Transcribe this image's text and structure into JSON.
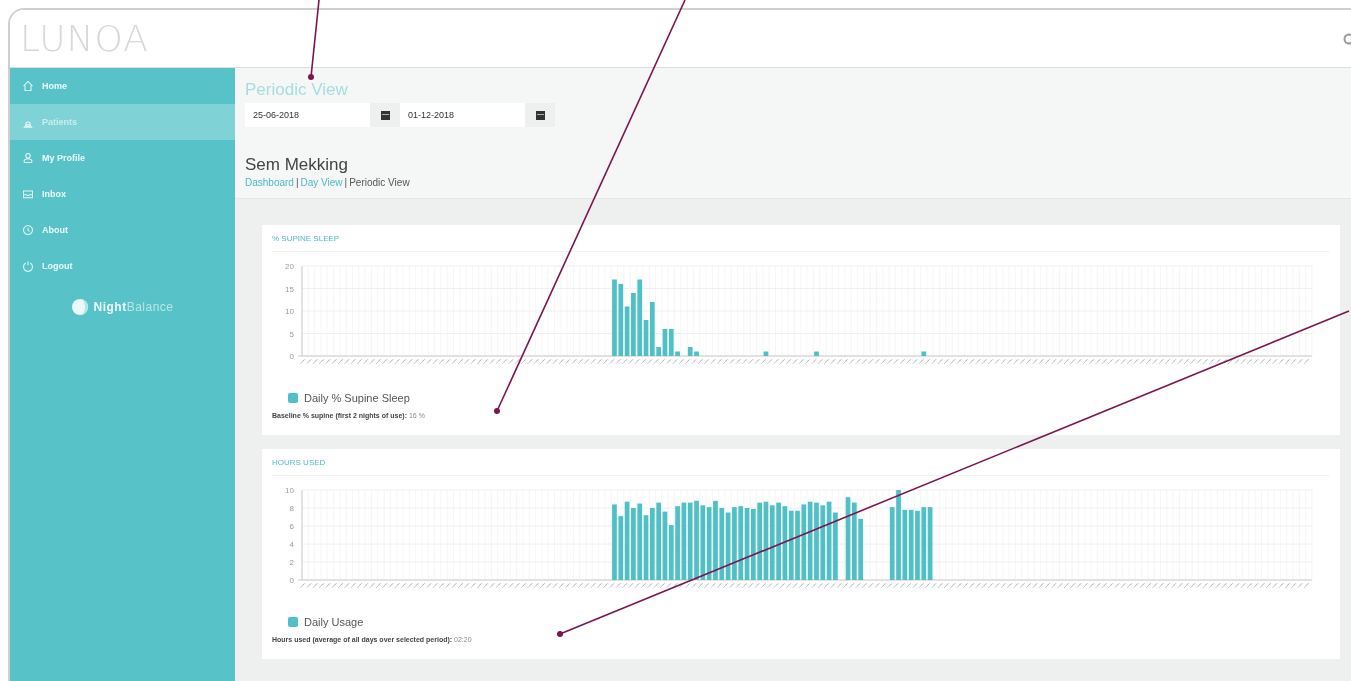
{
  "header": {
    "logo": "LUNOA"
  },
  "sidebar": {
    "items": [
      {
        "label": "Home",
        "selected": false
      },
      {
        "label": "Patients",
        "selected": true
      },
      {
        "label": "My Profile",
        "selected": false
      },
      {
        "label": "Inbox",
        "selected": false
      },
      {
        "label": "About",
        "selected": false
      },
      {
        "label": "Logout",
        "selected": false
      }
    ],
    "brand": "**Night**Balance"
  },
  "page_title": "Periodic View",
  "date_range": {
    "from": "25-06-2018",
    "to": "01-12-2018"
  },
  "patient_name": "Sem Mekking",
  "breadcrumb": [
    {
      "label": "Dashboard",
      "kind": "link"
    },
    {
      "label": "|",
      "kind": "sep"
    },
    {
      "label": "Day View",
      "kind": "link"
    },
    {
      "label": "|",
      "kind": "sep"
    },
    {
      "label": "Periodic View",
      "kind": "current"
    }
  ],
  "cards": [
    {
      "title": "% SUPINE SLEEP",
      "summary": "**Baseline % supine (first 2 nights of use):** 16 %",
      "chart_data": {
        "type": "bar",
        "grid": true,
        "ylim": [
          0,
          20
        ],
        "yticks": [
          0,
          5,
          10,
          15,
          20
        ],
        "series": [
          {
            "name": "Daily % Supine Sleep",
            "color": "#4fc1c6",
            "values": [
              null,
              null,
              null,
              null,
              null,
              null,
              null,
              null,
              null,
              null,
              null,
              null,
              null,
              null,
              null,
              null,
              null,
              null,
              null,
              null,
              null,
              null,
              null,
              null,
              null,
              null,
              null,
              null,
              null,
              null,
              null,
              null,
              null,
              null,
              null,
              null,
              null,
              null,
              null,
              null,
              null,
              null,
              null,
              null,
              null,
              null,
              null,
              null,
              null,
              17,
              16,
              11,
              14,
              17,
              8,
              12,
              2,
              6,
              6,
              1,
              null,
              2,
              1,
              null,
              null,
              null,
              null,
              null,
              null,
              null,
              null,
              null,
              null,
              1,
              null,
              null,
              null,
              null,
              null,
              null,
              null,
              1,
              null,
              null,
              null,
              null,
              null,
              null,
              null,
              null,
              null,
              null,
              null,
              null,
              null,
              null,
              null,
              null,
              1,
              null,
              null,
              null,
              null,
              null,
              null,
              null,
              null,
              null,
              null,
              null,
              null,
              null,
              null,
              null,
              null,
              null,
              null,
              null,
              null,
              null,
              null,
              null,
              null,
              null,
              null,
              null,
              null,
              null,
              null,
              null,
              null,
              null,
              null,
              null,
              null,
              null,
              null,
              null,
              null,
              null,
              null,
              null,
              null,
              null,
              null,
              null,
              null,
              null,
              null,
              null,
              null,
              null,
              null,
              null,
              null,
              null,
              null,
              null,
              null,
              null
            ]
          }
        ]
      }
    },
    {
      "title": "HOURS USED",
      "summary": "**Hours used (average of all days over selected period):** 02:20",
      "chart_data": {
        "type": "bar",
        "grid": true,
        "ylim": [
          0,
          10
        ],
        "yticks": [
          0,
          2,
          4,
          6,
          8,
          10
        ],
        "series": [
          {
            "name": "Daily Usage",
            "color": "#4fc1c6",
            "values": [
              null,
              null,
              null,
              null,
              null,
              null,
              null,
              null,
              null,
              null,
              null,
              null,
              null,
              null,
              null,
              null,
              null,
              null,
              null,
              null,
              null,
              null,
              null,
              null,
              null,
              null,
              null,
              null,
              null,
              null,
              null,
              null,
              null,
              null,
              null,
              null,
              null,
              null,
              null,
              null,
              null,
              null,
              null,
              null,
              null,
              null,
              null,
              null,
              null,
              8.4,
              7.1,
              8.7,
              8,
              8.5,
              7.2,
              8,
              8.6,
              7.6,
              6.1,
              8.2,
              8.6,
              8.6,
              8.8,
              8.3,
              8.1,
              8.8,
              8,
              7.5,
              8.1,
              8.2,
              8,
              7.9,
              8.6,
              8.7,
              8.3,
              8.6,
              8.2,
              7.7,
              7.7,
              8.4,
              8.7,
              8.6,
              8.3,
              8.7,
              7.5,
              null,
              9.2,
              8.6,
              6.8,
              null,
              null,
              null,
              null,
              8.1,
              10,
              7.8,
              7.8,
              7.7,
              8.1,
              8.1,
              null,
              null,
              null,
              null,
              null,
              null,
              null,
              null,
              null,
              null,
              null,
              null,
              null,
              null,
              null,
              null,
              null,
              null,
              null,
              null,
              null,
              null,
              null,
              null,
              null,
              null,
              null,
              null,
              null,
              null,
              null,
              null,
              null,
              null,
              null,
              null,
              null,
              null,
              null,
              null,
              null,
              null,
              null,
              null,
              null,
              null,
              null,
              null,
              null,
              null,
              null,
              null,
              null,
              null,
              null,
              null,
              null,
              null,
              null,
              null
            ]
          }
        ]
      }
    }
  ]
}
